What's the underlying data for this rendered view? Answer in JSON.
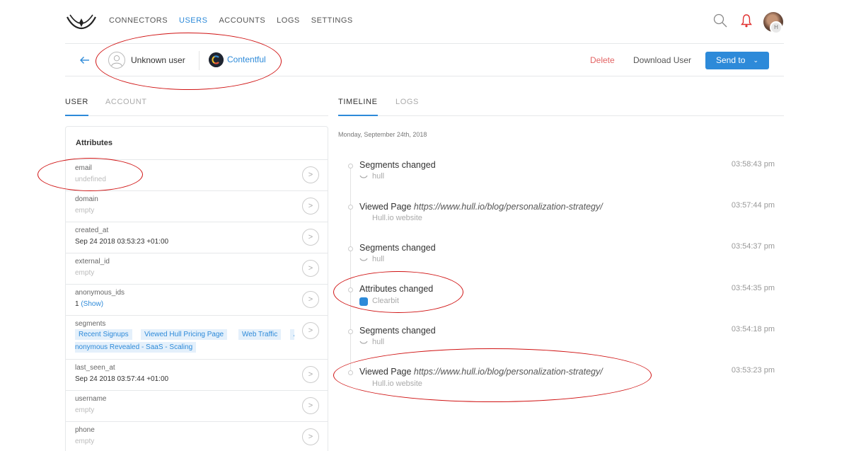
{
  "nav": {
    "links": [
      "CONNECTORS",
      "USERS",
      "ACCOUNTS",
      "LOGS",
      "SETTINGS"
    ],
    "active": "USERS",
    "avatar_badge": "H"
  },
  "userbar": {
    "user_name": "Unknown user",
    "connector_name": "Contentful",
    "delete_label": "Delete",
    "download_label": "Download User",
    "send_label": "Send to"
  },
  "left_tabs": [
    "USER",
    "ACCOUNT"
  ],
  "right_tabs": [
    "TIMELINE",
    "LOGS"
  ],
  "attributes": {
    "title": "Attributes",
    "rows": [
      {
        "key": "email",
        "value": "undefined"
      },
      {
        "key": "domain",
        "value": "empty"
      },
      {
        "key": "created_at",
        "value": "Sep 24 2018 03:53:23 +01:00"
      },
      {
        "key": "external_id",
        "value": "empty"
      },
      {
        "key": "anonymous_ids",
        "value": "1",
        "link": "(Show)"
      },
      {
        "key": "segments",
        "tags": [
          "Recent Signups",
          "Viewed Hull Pricing Page",
          "Web Traffic",
          "A",
          "nonymous Revealed - SaaS - Scaling"
        ]
      },
      {
        "key": "last_seen_at",
        "value": "Sep 24 2018 03:57:44 +01:00"
      },
      {
        "key": "username",
        "value": "empty"
      },
      {
        "key": "phone",
        "value": "empty"
      }
    ]
  },
  "timeline": {
    "date": "Monday, September 24th, 2018",
    "events": [
      {
        "title": "Segments changed",
        "url": "",
        "source": "hull",
        "time": "03:58:43 pm"
      },
      {
        "title": "Viewed Page",
        "url": "https://www.hull.io/blog/personalization-strategy/",
        "source": "Hull.io website",
        "time": "03:57:44 pm"
      },
      {
        "title": "Segments changed",
        "url": "",
        "source": "hull",
        "time": "03:54:37 pm"
      },
      {
        "title": "Attributes changed",
        "url": "",
        "source": "Clearbit",
        "time": "03:54:35 pm"
      },
      {
        "title": "Segments changed",
        "url": "",
        "source": "hull",
        "time": "03:54:18 pm"
      },
      {
        "title": "Viewed Page",
        "url": "https://www.hull.io/blog/personalization-strategy/",
        "source": "Hull.io website",
        "time": "03:53:23 pm"
      }
    ]
  },
  "colors": {
    "accent": "#2d8ad9",
    "danger": "#e36464",
    "annotation": "#d01313"
  }
}
